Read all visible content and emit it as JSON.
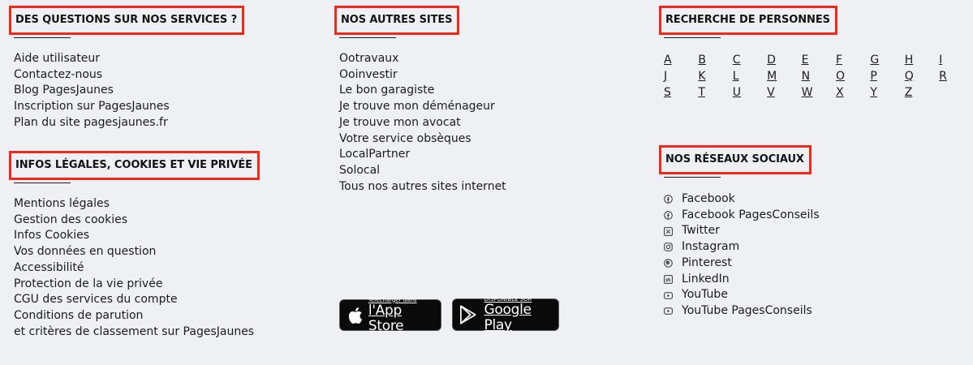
{
  "col1": {
    "heading": "DES QUESTIONS SUR NOS SERVICES ?",
    "links": [
      "Aide utilisateur",
      "Contactez-nous",
      "Blog PagesJaunes",
      "Inscription sur PagesJaunes",
      "Plan du site pagesjaunes.fr"
    ],
    "heading2": "INFOS LÉGALES, COOKIES ET VIE PRIVÉE",
    "links2": [
      "Mentions légales",
      "Gestion des cookies",
      "Infos Cookies",
      "Vos données en question",
      "Accessibilité",
      "Protection de la vie privée",
      "CGU des services du compte",
      "Conditions de parution",
      "et critères de classement sur PagesJaunes"
    ]
  },
  "col2": {
    "heading": "NOS AUTRES SITES",
    "links": [
      "Ootravaux",
      "Ooinvestir",
      "Le bon garagiste",
      "Je trouve mon déménageur",
      "Je trouve mon avocat",
      "Votre service obsèques",
      "LocalPartner",
      "Solocal",
      "Tous nos autres sites internet"
    ],
    "appstore": {
      "small": "Télécharger dans",
      "big": "l'App Store"
    },
    "googleplay": {
      "small": "DISPONIBLE SUR",
      "big": "Google Play"
    }
  },
  "col3": {
    "heading": "RECHERCHE DE PERSONNES",
    "letter_rows": [
      [
        "A",
        "B",
        "C",
        "D",
        "E",
        "F",
        "G",
        "H",
        "I"
      ],
      [
        "J",
        "K",
        "L",
        "M",
        "N",
        "O",
        "P",
        "Q",
        "R"
      ],
      [
        "S",
        "T",
        "U",
        "V",
        "W",
        "X",
        "Y",
        "Z"
      ]
    ],
    "heading2": "NOS RÉSEAUX SOCIAUX",
    "social": [
      {
        "label": "Facebook",
        "icon": "facebook-icon"
      },
      {
        "label": "Facebook PagesConseils",
        "icon": "facebook-icon"
      },
      {
        "label": "Twitter",
        "icon": "x-twitter-icon"
      },
      {
        "label": "Instagram",
        "icon": "instagram-icon"
      },
      {
        "label": "Pinterest",
        "icon": "pinterest-icon"
      },
      {
        "label": "LinkedIn",
        "icon": "linkedin-icon"
      },
      {
        "label": "YouTube",
        "icon": "youtube-icon"
      },
      {
        "label": "YouTube PagesConseils",
        "icon": "youtube-icon"
      }
    ]
  }
}
